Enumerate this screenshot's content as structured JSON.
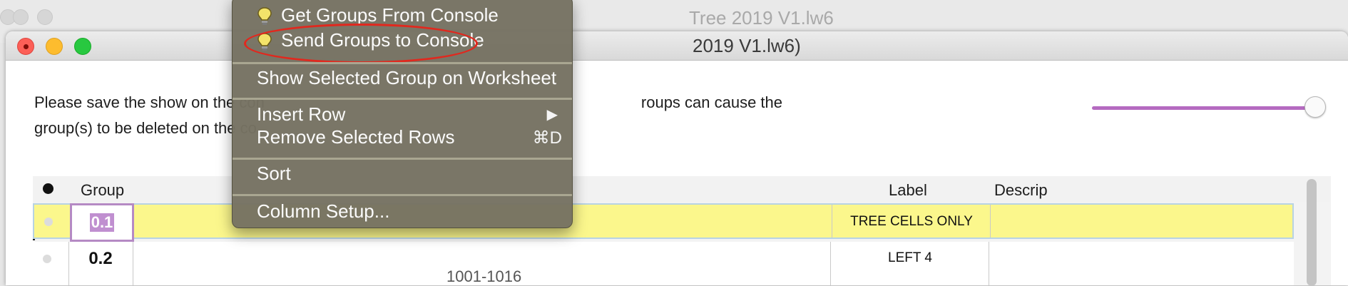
{
  "back_window": {
    "title": "Tree 2019 V1.lw6"
  },
  "front_window": {
    "title": "2019 V1.lw6)",
    "notice_line1_start": "Please save the show on the con",
    "notice_line1_end": "roups can cause the",
    "notice_line2_start": "group(s) to be deleted on the co"
  },
  "context_menu": {
    "get_groups": "Get Groups From Console",
    "send_groups": "Send Groups to Console",
    "show_selected": "Show Selected Group on Worksheet",
    "insert_row": "Insert Row",
    "insert_row_arrow": "▶",
    "remove_rows": "Remove Selected Rows",
    "remove_rows_shortcut": "⌘D",
    "sort": "Sort",
    "column_setup": "Column Setup..."
  },
  "table": {
    "headers": {
      "group": "Group",
      "label": "Label",
      "descrip": "Descrip"
    },
    "rows": [
      {
        "group": "0.1",
        "label": "TREE CELLS ONLY"
      },
      {
        "group": "0.2",
        "middle": "1001-1016",
        "label": "LEFT 4"
      }
    ]
  },
  "colors": {
    "selected_row": "#fbf78c",
    "slider_accent": "#b56ac0",
    "annotation": "#e1281e"
  }
}
